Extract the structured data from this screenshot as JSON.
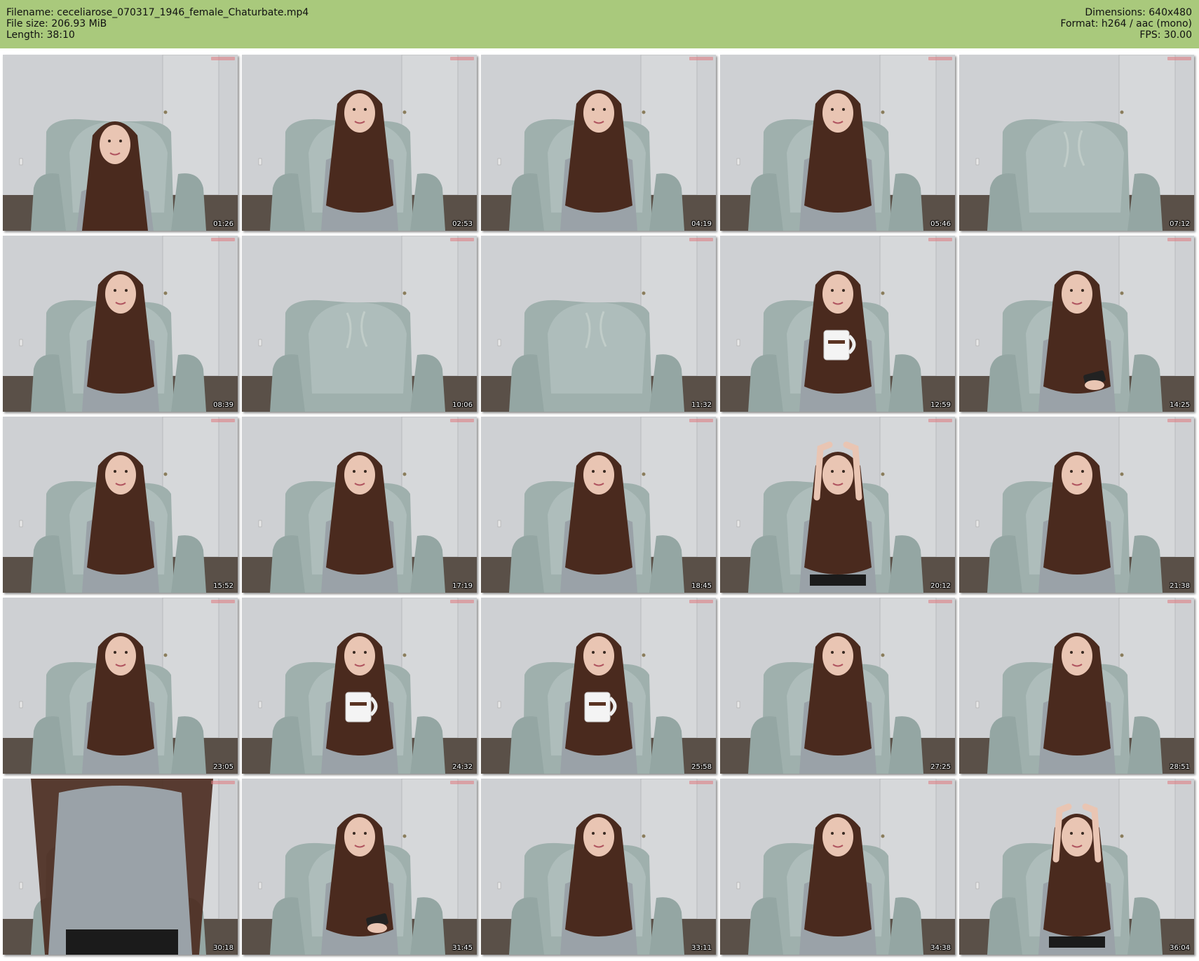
{
  "header": {
    "filename": "Filename: ceceliarose_070317_1946_female_Chaturbate.mp4",
    "filesize": "File size: 206.93 MiB",
    "length": "Length: 38:10",
    "dimensions": "Dimensions: 640x480",
    "format": "Format: h264 / aac (mono)",
    "fps": "FPS: 30.00"
  },
  "colors": {
    "header_bg": "#a9c97c",
    "wall": "#c8cacd",
    "floor": "#5a5048",
    "chair": "#9fb0ad",
    "hair": "#4a2a1e",
    "dress": "#9aa2a8",
    "skin": "#e9c5b3"
  },
  "thumbnails": [
    {
      "time": "01:26",
      "person": "lean",
      "mug": false,
      "phone": false
    },
    {
      "time": "02:53",
      "person": "sit",
      "mug": false,
      "phone": false
    },
    {
      "time": "04:19",
      "person": "sit",
      "mug": false,
      "phone": false
    },
    {
      "time": "05:46",
      "person": "sit",
      "mug": false,
      "phone": false
    },
    {
      "time": "07:12",
      "person": "none",
      "mug": false,
      "phone": false
    },
    {
      "time": "08:39",
      "person": "sit",
      "mug": false,
      "phone": false
    },
    {
      "time": "10:06",
      "person": "none",
      "mug": false,
      "phone": false
    },
    {
      "time": "11:32",
      "person": "none",
      "mug": false,
      "phone": false
    },
    {
      "time": "12:59",
      "person": "sit",
      "mug": true,
      "phone": false
    },
    {
      "time": "14:25",
      "person": "sit",
      "mug": false,
      "phone": true
    },
    {
      "time": "15:52",
      "person": "sit",
      "mug": false,
      "phone": false
    },
    {
      "time": "17:19",
      "person": "sit",
      "mug": false,
      "phone": false
    },
    {
      "time": "18:45",
      "person": "sit",
      "mug": false,
      "phone": false
    },
    {
      "time": "20:12",
      "person": "arms-up",
      "mug": false,
      "phone": false
    },
    {
      "time": "21:38",
      "person": "sit",
      "mug": false,
      "phone": false
    },
    {
      "time": "23:05",
      "person": "sit",
      "mug": false,
      "phone": false
    },
    {
      "time": "24:32",
      "person": "sit",
      "mug": true,
      "phone": false
    },
    {
      "time": "25:58",
      "person": "sit",
      "mug": true,
      "phone": false
    },
    {
      "time": "27:25",
      "person": "sit",
      "mug": false,
      "phone": false
    },
    {
      "time": "28:51",
      "person": "sit",
      "mug": false,
      "phone": false
    },
    {
      "time": "30:18",
      "person": "standing-close",
      "mug": false,
      "phone": false
    },
    {
      "time": "31:45",
      "person": "sit",
      "mug": false,
      "phone": true
    },
    {
      "time": "33:11",
      "person": "sit",
      "mug": false,
      "phone": false
    },
    {
      "time": "34:38",
      "person": "sit",
      "mug": false,
      "phone": false
    },
    {
      "time": "36:04",
      "person": "arms-up",
      "mug": false,
      "phone": false
    }
  ]
}
